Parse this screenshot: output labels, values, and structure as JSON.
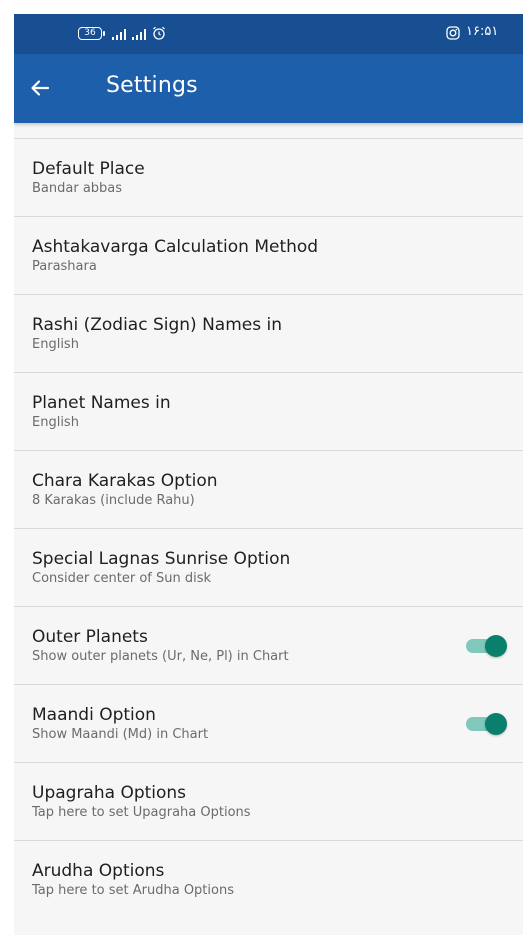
{
  "status_bar": {
    "battery_level": "36",
    "time": "۱۶:۵۱"
  },
  "app_bar": {
    "title": "Settings"
  },
  "settings": [
    {
      "title": "Default Place",
      "summary": "Bandar abbas"
    },
    {
      "title": "Ashtakavarga Calculation Method",
      "summary": "Parashara"
    },
    {
      "title": "Rashi (Zodiac Sign) Names in",
      "summary": "English"
    },
    {
      "title": "Planet Names in",
      "summary": "English"
    },
    {
      "title": "Chara Karakas Option",
      "summary": "8 Karakas (include Rahu)"
    },
    {
      "title": "Special Lagnas Sunrise Option",
      "summary": "Consider center of Sun disk"
    },
    {
      "title": "Outer Planets",
      "summary": "Show outer planets (Ur, Ne, Pl) in Chart",
      "toggle_on": true
    },
    {
      "title": "Maandi Option",
      "summary": "Show Maandi (Md) in Chart",
      "toggle_on": true
    },
    {
      "title": "Upagraha Options",
      "summary": "Tap here to set Upagraha Options"
    },
    {
      "title": "Arudha Options",
      "summary": "Tap here to set Arudha Options"
    }
  ],
  "colors": {
    "status_bar": "#174f92",
    "app_bar": "#1d5faa",
    "toggle_thumb": "#0a7f6b",
    "toggle_track": "#80c7bc"
  }
}
